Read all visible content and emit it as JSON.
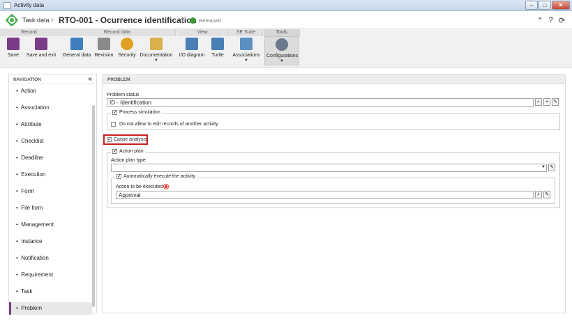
{
  "window": {
    "title": "Activity data"
  },
  "header": {
    "breadcrumb_root": "Task data",
    "title": "RTO-001 - Ocurrence identification",
    "status": "Released"
  },
  "ribbon": {
    "groups": {
      "record": "Record",
      "record_data": "Record data",
      "view": "View",
      "se_suite": "SE Suite",
      "tools": "Tools"
    },
    "buttons": {
      "save": "Save",
      "save_exit": "Save and exit",
      "general_data": "General data",
      "revision": "Revision",
      "security": "Security",
      "documentation": "Documentation",
      "io_diagram": "I/O diagram",
      "turtle": "Turtle",
      "associations": "Associations",
      "configurations": "Configurations"
    }
  },
  "navigation": {
    "heading": "NAVIGATION",
    "items": [
      "Action",
      "Association",
      "Attribute",
      "Checklist",
      "Deadline",
      "Execution",
      "Form",
      "File form",
      "Management",
      "Instance",
      "Notification",
      "Requirement",
      "Task",
      "Problem"
    ],
    "active": "Problem"
  },
  "problem": {
    "heading": "PROBLEM",
    "problem_status_label": "Problem status",
    "problem_status_value": "ID - Identification",
    "process_simulation_label": "Process simulation",
    "process_simulation_checked": true,
    "no_edit_label": "Do not allow to edit records of another activity",
    "no_edit_checked": false,
    "cause_analysis_label": "Cause analysis",
    "cause_analysis_checked": true,
    "action_plan_label": "Action plan",
    "action_plan_checked": true,
    "action_plan_type_label": "Action plan type",
    "action_plan_type_value": "",
    "auto_execute_label": "Automatically execute the activity",
    "auto_execute_checked": true,
    "action_to_execute_label": "Action to be executed",
    "action_to_execute_value": "Approval"
  }
}
